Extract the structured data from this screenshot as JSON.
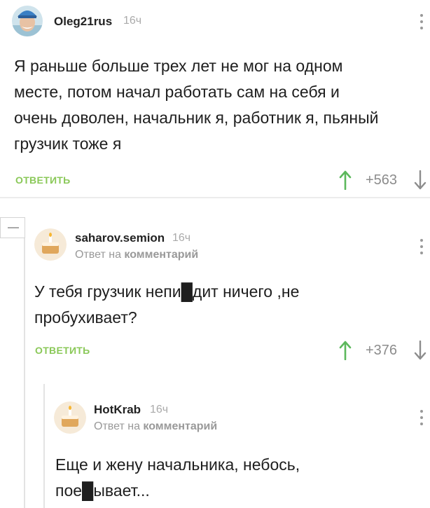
{
  "comments": [
    {
      "username": "Oleg21rus",
      "time": "16ч",
      "text_lines": [
        "Я раньше больше трех лет не мог на одном",
        "месте, потом начал работать сам на себя и",
        "очень доволен, начальник я, работник я, пьяный",
        "грузчик тоже я"
      ],
      "reply_label": "ОТВЕТИТЬ",
      "rating": "+563"
    },
    {
      "username": "saharov.semion",
      "time": "16ч",
      "reply_prefix": "Ответ на",
      "reply_target": "комментарий",
      "text_lines": [
        "У тебя грузчик непи█дит ничего ,не",
        "пробухивает?"
      ],
      "reply_label": "ОТВЕТИТЬ",
      "rating": "+376"
    },
    {
      "username": "HotKrab",
      "time": "16ч",
      "reply_prefix": "Ответ на",
      "reply_target": "комментарий",
      "text_lines": [
        "Еще и жену начальника, небось,",
        "пое█ывает..."
      ]
    }
  ],
  "colors": {
    "accent": "#8ac858",
    "upvote": "#5cb85c",
    "muted": "#999999"
  },
  "icons": [
    "avatar",
    "cake-avatar-icon",
    "upvote-arrow-icon",
    "downvote-arrow-icon",
    "more-dots-icon",
    "collapse-thread-icon"
  ]
}
